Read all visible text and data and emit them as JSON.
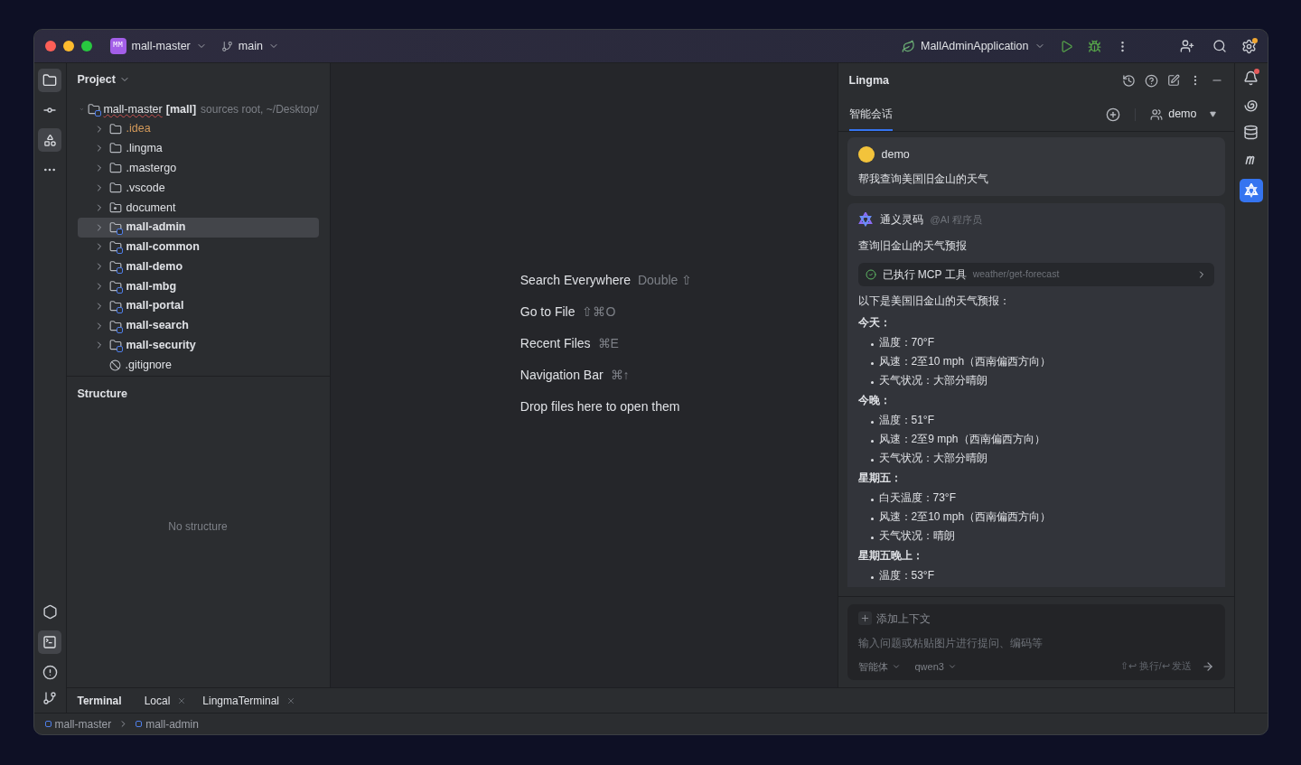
{
  "title_bar": {
    "project_badge": "MM",
    "project": "mall-master",
    "branch": "main",
    "run_config": "MallAdminApplication"
  },
  "project_panel": {
    "title": "Project",
    "tree": {
      "name": "mall-master",
      "module": "[mall]",
      "hint": "sources root, ~/Desktop/",
      "expanded": true,
      "children": [
        {
          "name": ".idea",
          "kind": "folder",
          "color": "#d49a5a",
          "selected": false
        },
        {
          "name": ".lingma",
          "kind": "folder",
          "color": "#dfe1e5",
          "selected": false
        },
        {
          "name": ".mastergo",
          "kind": "folder",
          "color": "#dfe1e5",
          "selected": false
        },
        {
          "name": ".vscode",
          "kind": "folder",
          "color": "#dfe1e5",
          "selected": false
        },
        {
          "name": "document",
          "kind": "resource",
          "color": "#dfe1e5",
          "selected": false
        },
        {
          "name": "mall-admin",
          "kind": "module",
          "color": "#dfe1e5",
          "selected": true
        },
        {
          "name": "mall-common",
          "kind": "module",
          "color": "#dfe1e5",
          "selected": false
        },
        {
          "name": "mall-demo",
          "kind": "module",
          "color": "#dfe1e5",
          "selected": false
        },
        {
          "name": "mall-mbg",
          "kind": "module",
          "color": "#dfe1e5",
          "selected": false
        },
        {
          "name": "mall-portal",
          "kind": "module",
          "color": "#dfe1e5",
          "selected": false
        },
        {
          "name": "mall-search",
          "kind": "module",
          "color": "#dfe1e5",
          "selected": false
        },
        {
          "name": "mall-security",
          "kind": "module",
          "color": "#dfe1e5",
          "selected": false
        },
        {
          "name": ".gitignore",
          "kind": "ignore",
          "color": "#dfe1e5",
          "selected": false
        }
      ]
    }
  },
  "structure_panel": {
    "title": "Structure",
    "empty_text": "No structure"
  },
  "editor_hints": [
    {
      "label": "Search Everywhere",
      "shortcut": "Double ⇧"
    },
    {
      "label": "Go to File",
      "shortcut": "⇧⌘O"
    },
    {
      "label": "Recent Files",
      "shortcut": "⌘E"
    },
    {
      "label": "Navigation Bar",
      "shortcut": "⌘↑"
    },
    {
      "label": "Drop files here to open them"
    }
  ],
  "lingma": {
    "title": "Lingma",
    "tabs": [
      {
        "label": "智能会话",
        "selected": true
      }
    ],
    "user": "demo",
    "messages": [
      {
        "kind": "user",
        "author": "demo",
        "text": "帮我查询美国旧金山的天气"
      },
      {
        "kind": "assistant",
        "author": "通义灵码",
        "role": "@AI 程序员",
        "blocks": [
          {
            "kind": "paragraph",
            "text": "查询旧金山的天气预报"
          },
          {
            "kind": "tool",
            "label": "已执行 MCP 工具",
            "name": "weather/get-forecast"
          },
          {
            "kind": "paragraph",
            "text": "以下是美国旧金山的天气预报："
          },
          {
            "kind": "heading",
            "text": "今天：",
            "items": [
              "温度：70°F",
              "风速：2至10 mph（西南偏西方向）",
              "天气状况：大部分晴朗"
            ]
          },
          {
            "kind": "heading",
            "text": "今晚：",
            "items": [
              "温度：51°F",
              "风速：2至9 mph（西南偏西方向）",
              "天气状况：大部分晴朗"
            ]
          },
          {
            "kind": "heading",
            "text": "星期五：",
            "items": [
              "白天温度：73°F",
              "风速：2至10 mph（西南偏西方向）",
              "天气状况：晴朗"
            ]
          },
          {
            "kind": "heading",
            "text": "星期五晚上：",
            "items": [
              "温度：53°F"
            ]
          }
        ]
      }
    ],
    "input": {
      "context_button": "添加上下文",
      "placeholder": "输入问题或粘贴图片进行提问、编码等",
      "agent": "智能体",
      "model": "qwen3",
      "hint": "⇧↩ 换行/↩ 发送"
    }
  },
  "bottom_tabs": {
    "title": "Terminal",
    "tabs": [
      "Local",
      "LingmaTerminal"
    ]
  },
  "status_bar": {
    "breadcrumbs": [
      "mall-master",
      "mall-admin"
    ]
  }
}
